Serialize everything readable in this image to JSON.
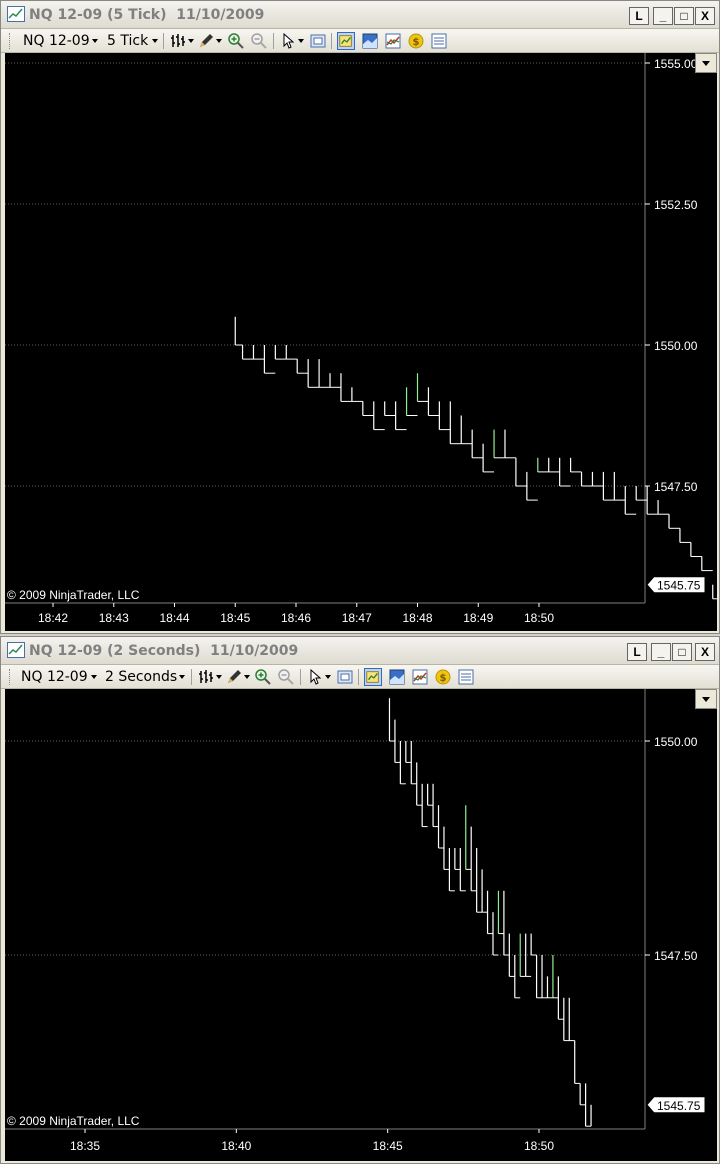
{
  "windows": [
    {
      "title": "NQ 12-09 (5 Tick)  11/10/2009",
      "instrument": "NQ 12-09",
      "period": "5 Tick",
      "copyright": "© 2009 NinjaTrader, LLC",
      "price_labels": [
        "1555.00",
        "1552.50",
        "1550.00",
        "1547.50"
      ],
      "last_price": "1545.75",
      "time_labels": [
        "18:42",
        "18:43",
        "18:44",
        "18:45",
        "18:46",
        "18:47",
        "18:48",
        "18:49",
        "18:50"
      ]
    },
    {
      "title": "NQ 12-09 (2 Seconds)  11/10/2009",
      "instrument": "NQ 12-09",
      "period": "2 Seconds",
      "copyright": "© 2009 NinjaTrader, LLC",
      "price_labels": [
        "1550.00",
        "1547.50"
      ],
      "last_price": "1545.75",
      "time_labels": [
        "18:35",
        "18:40",
        "18:45",
        "18:50"
      ]
    }
  ],
  "buttons": {
    "link": "L",
    "minimize": "_",
    "maximize": "□",
    "close": "X"
  },
  "colors": {
    "chart_bg": "#000000",
    "bar": "#ffffff",
    "bar_up": "#90ee90",
    "grid": "#808080",
    "axis_text": "#ffffff"
  },
  "icons": [
    "bar-type-icon",
    "draw-tool-icon",
    "zoom-in-icon",
    "zoom-out-icon",
    "cursor-icon",
    "snapshot-icon",
    "data-box-icon",
    "chart-properties-icon",
    "indicators-icon",
    "strategy-icon",
    "order-list-icon"
  ],
  "chart_data": [
    {
      "type": "line",
      "x_ticks": [
        "18:42",
        "18:43",
        "18:44",
        "18:45",
        "18:46",
        "18:47",
        "18:48",
        "18:49",
        "18:50"
      ],
      "y_ticks": [
        1547.5,
        1550.0,
        1552.5,
        1555.0
      ],
      "ylim": [
        1545.25,
        1555.25
      ],
      "xlim": [
        18.69,
        18.885
      ],
      "last_price": 1545.75,
      "bars": [
        [
          18.75,
          1550.5,
          1550.0
        ],
        [
          18.752,
          1550.0,
          1549.75
        ],
        [
          18.755,
          1550.0,
          1549.75
        ],
        [
          18.758,
          1550.0,
          1549.5
        ],
        [
          18.761,
          1550.0,
          1549.75
        ],
        [
          18.764,
          1550.0,
          1549.75
        ],
        [
          18.767,
          1549.75,
          1549.5
        ],
        [
          18.77,
          1549.75,
          1549.25
        ],
        [
          18.773,
          1549.75,
          1549.25
        ],
        [
          18.776,
          1549.5,
          1549.25
        ],
        [
          18.779,
          1549.5,
          1549.0
        ],
        [
          18.782,
          1549.25,
          1549.0
        ],
        [
          18.785,
          1549.0,
          1548.75
        ],
        [
          18.788,
          1549.0,
          1548.5
        ],
        [
          18.791,
          1549.0,
          1548.75
        ],
        [
          18.794,
          1549.0,
          1548.5
        ],
        [
          18.797,
          1549.25,
          1548.75
        ],
        [
          18.8,
          1549.5,
          1549.0
        ],
        [
          18.803,
          1549.25,
          1548.75
        ],
        [
          18.806,
          1549.0,
          1548.5
        ],
        [
          18.809,
          1549.0,
          1548.25
        ],
        [
          18.812,
          1548.75,
          1548.25
        ],
        [
          18.815,
          1548.5,
          1548.0
        ],
        [
          18.818,
          1548.25,
          1547.75
        ],
        [
          18.821,
          1548.5,
          1548.0
        ],
        [
          18.824,
          1548.5,
          1548.0
        ],
        [
          18.827,
          1548.0,
          1547.5
        ],
        [
          18.83,
          1547.75,
          1547.25
        ],
        [
          18.833,
          1548.0,
          1547.75
        ],
        [
          18.836,
          1548.0,
          1547.75
        ],
        [
          18.839,
          1548.0,
          1547.5
        ],
        [
          18.842,
          1548.0,
          1547.75
        ],
        [
          18.845,
          1547.75,
          1547.5
        ],
        [
          18.848,
          1547.75,
          1547.5
        ],
        [
          18.851,
          1547.75,
          1547.25
        ],
        [
          18.854,
          1547.75,
          1547.25
        ],
        [
          18.857,
          1547.5,
          1547.0
        ],
        [
          18.86,
          1547.5,
          1547.25
        ],
        [
          18.863,
          1547.5,
          1547.0
        ],
        [
          18.866,
          1547.25,
          1547.0
        ],
        [
          18.869,
          1547.0,
          1546.75
        ],
        [
          18.872,
          1546.75,
          1546.5
        ],
        [
          18.875,
          1546.5,
          1546.25
        ],
        [
          18.878,
          1546.25,
          1546.0
        ],
        [
          18.881,
          1545.75,
          1545.5
        ],
        [
          18.883,
          1545.75,
          1545.5
        ]
      ]
    },
    {
      "type": "line",
      "x_ticks": [
        "18:35",
        "18:40",
        "18:45",
        "18:50"
      ],
      "y_ticks": [
        1547.5,
        1550.0
      ],
      "ylim": [
        1545.25,
        1550.5
      ],
      "xlim": [
        18.55,
        18.885
      ],
      "last_price": 1545.75,
      "bars": [
        [
          18.751,
          1550.5,
          1550.0
        ],
        [
          18.754,
          1550.25,
          1549.75
        ],
        [
          18.757,
          1550.0,
          1549.5
        ],
        [
          18.76,
          1550.0,
          1549.75
        ],
        [
          18.763,
          1550.0,
          1549.5
        ],
        [
          18.766,
          1549.75,
          1549.25
        ],
        [
          18.769,
          1549.5,
          1549.0
        ],
        [
          18.772,
          1549.5,
          1549.25
        ],
        [
          18.775,
          1549.5,
          1549.0
        ],
        [
          18.778,
          1549.25,
          1548.75
        ],
        [
          18.781,
          1549.0,
          1548.5
        ],
        [
          18.784,
          1548.75,
          1548.25
        ],
        [
          18.787,
          1548.75,
          1548.5
        ],
        [
          18.79,
          1548.75,
          1548.25
        ],
        [
          18.793,
          1549.25,
          1548.5
        ],
        [
          18.796,
          1549.0,
          1548.25
        ],
        [
          18.799,
          1548.75,
          1548.0
        ],
        [
          18.802,
          1548.5,
          1548.0
        ],
        [
          18.805,
          1548.25,
          1547.75
        ],
        [
          18.808,
          1548.0,
          1547.5
        ],
        [
          18.811,
          1548.25,
          1547.75
        ],
        [
          18.814,
          1548.25,
          1547.5
        ],
        [
          18.817,
          1547.75,
          1547.25
        ],
        [
          18.82,
          1547.5,
          1547.0
        ],
        [
          18.823,
          1547.75,
          1547.25
        ],
        [
          18.826,
          1547.75,
          1547.25
        ],
        [
          18.829,
          1547.75,
          1547.5
        ],
        [
          18.832,
          1547.5,
          1547.0
        ],
        [
          18.835,
          1547.5,
          1547.0
        ],
        [
          18.838,
          1547.25,
          1547.0
        ],
        [
          18.841,
          1547.5,
          1547.0
        ],
        [
          18.844,
          1547.25,
          1546.75
        ],
        [
          18.847,
          1547.0,
          1546.5
        ],
        [
          18.85,
          1547.0,
          1546.5
        ],
        [
          18.853,
          1546.5,
          1546.0
        ],
        [
          18.856,
          1546.0,
          1545.75
        ],
        [
          18.859,
          1546.0,
          1545.5
        ],
        [
          18.862,
          1545.75,
          1545.5
        ]
      ]
    }
  ]
}
